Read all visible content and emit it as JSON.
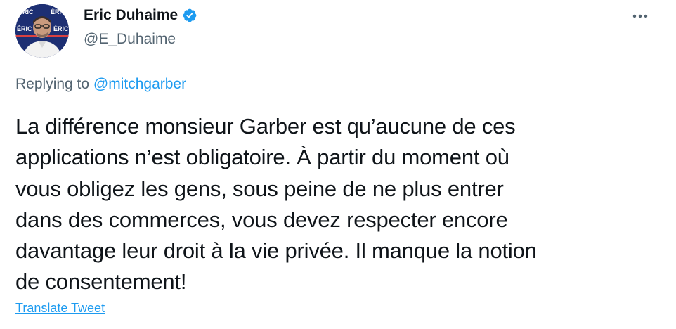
{
  "author": {
    "display_name": "Eric Duhaime",
    "handle": "@E_Duhaime",
    "verified": true,
    "avatar_backdrop_text": [
      "ÉRIC",
      "ÉRIC",
      "ÉRIC",
      "ÉRIC"
    ]
  },
  "icons": {
    "verified": "verified-badge-icon",
    "more": "more-options-icon"
  },
  "reply": {
    "prefix": "Replying to",
    "mention": "@mitchgarber"
  },
  "tweet": {
    "lines": [
      "La différence monsieur Garber est qu’aucune de ces",
      "applications n’est obligatoire. À partir du moment où",
      "vous obligez les gens, sous peine de ne plus entrer",
      "dans des commerces, vous devez respecter encore",
      "davantage leur droit à la vie privée. Il manque la notion",
      "de consentement!"
    ],
    "translate_label": "Translate Tweet"
  },
  "colors": {
    "text": "#0f1419",
    "secondary": "#536471",
    "accent": "#1d9bf0",
    "avatar_bg": "#1d2f73"
  }
}
